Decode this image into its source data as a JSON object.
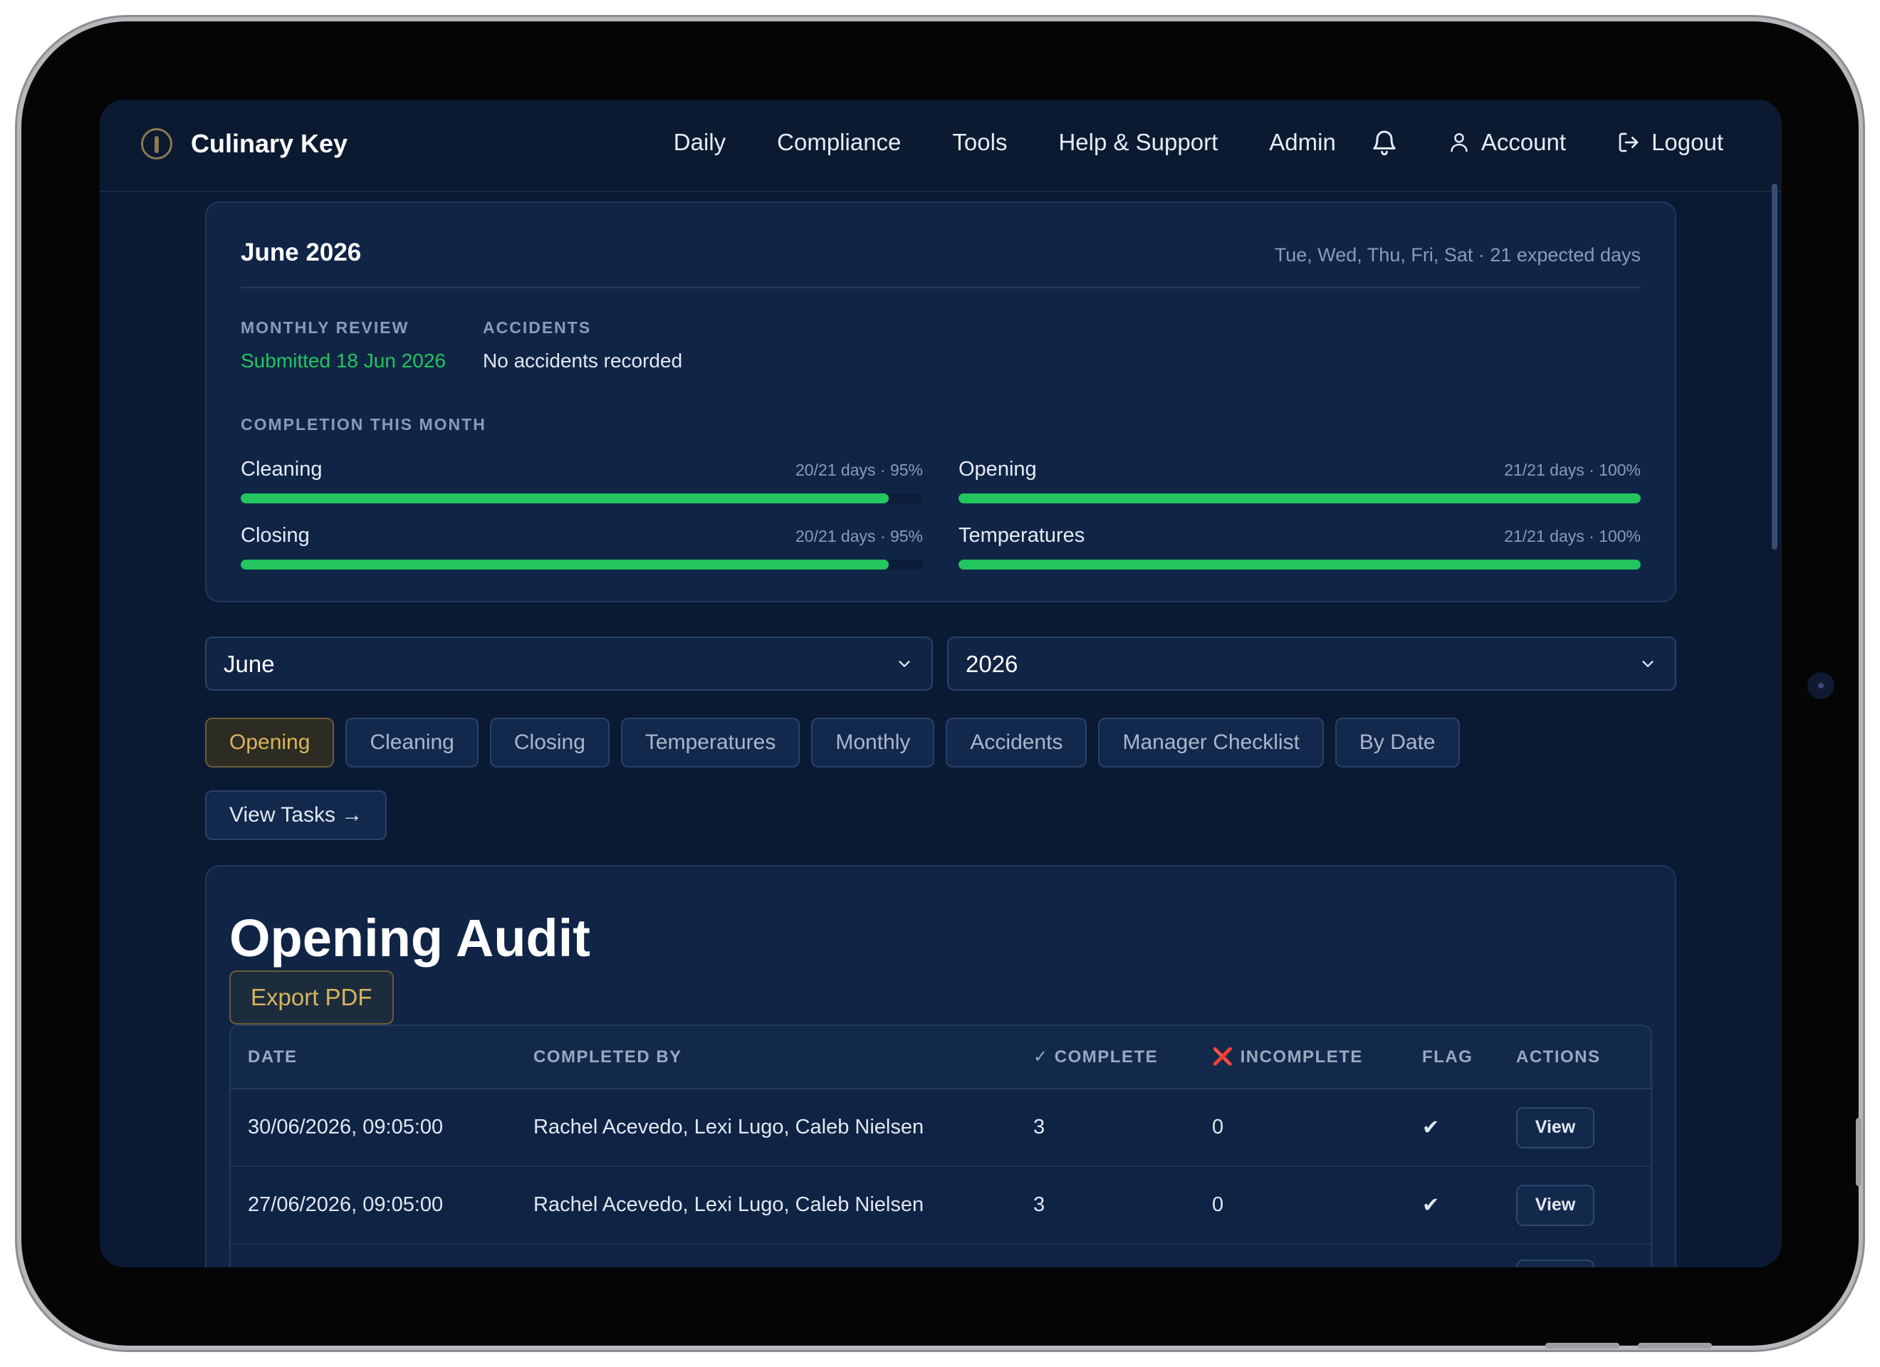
{
  "app": {
    "name": "Culinary Key"
  },
  "nav": {
    "daily": "Daily",
    "compliance": "Compliance",
    "tools": "Tools",
    "help": "Help & Support",
    "admin": "Admin",
    "account": "Account",
    "logout": "Logout",
    "icons": [
      "bell-icon",
      "user-icon",
      "logout-icon"
    ]
  },
  "summary": {
    "title": "June 2026",
    "schedule": "Tue, Wed, Thu, Fri, Sat · 21 expected days",
    "monthly_review_label": "MONTHLY REVIEW",
    "monthly_review_value": "Submitted 18 Jun 2026",
    "accidents_label": "ACCIDENTS",
    "accidents_value": "No accidents recorded",
    "completion_label": "COMPLETION THIS MONTH",
    "progress": [
      {
        "name": "Cleaning",
        "meta": "20/21 days · 95%",
        "percent": 95
      },
      {
        "name": "Opening",
        "meta": "21/21 days · 100%",
        "percent": 100
      },
      {
        "name": "Closing",
        "meta": "20/21 days · 95%",
        "percent": 95
      },
      {
        "name": "Temperatures",
        "meta": "21/21 days · 100%",
        "percent": 100
      }
    ],
    "colors": {
      "accent_green": "#22c55e",
      "accent_gold": "#d8b45c"
    }
  },
  "filters": {
    "month": "June",
    "year": "2026"
  },
  "tabs": [
    "Opening",
    "Cleaning",
    "Closing",
    "Temperatures",
    "Monthly",
    "Accidents",
    "Manager Checklist",
    "By Date"
  ],
  "active_tab": "Opening",
  "view_tasks": "View Tasks →",
  "audit": {
    "title": "Opening Audit",
    "export": "Export PDF",
    "columns": {
      "date": "DATE",
      "completed_by": "COMPLETED BY",
      "complete": "✓ COMPLETE",
      "incomplete_icon": "❌",
      "incomplete": "INCOMPLETE",
      "flag": "FLAG",
      "actions": "ACTIONS"
    },
    "rows": [
      {
        "date": "30/06/2026, 09:05:00",
        "completed_by": "Rachel Acevedo, Lexi Lugo, Caleb Nielsen",
        "complete": "3",
        "incomplete": "0",
        "flag": "✔",
        "action": "View"
      },
      {
        "date": "27/06/2026, 09:05:00",
        "completed_by": "Rachel Acevedo, Lexi Lugo, Caleb Nielsen",
        "complete": "3",
        "incomplete": "0",
        "flag": "✔",
        "action": "View"
      }
    ]
  }
}
